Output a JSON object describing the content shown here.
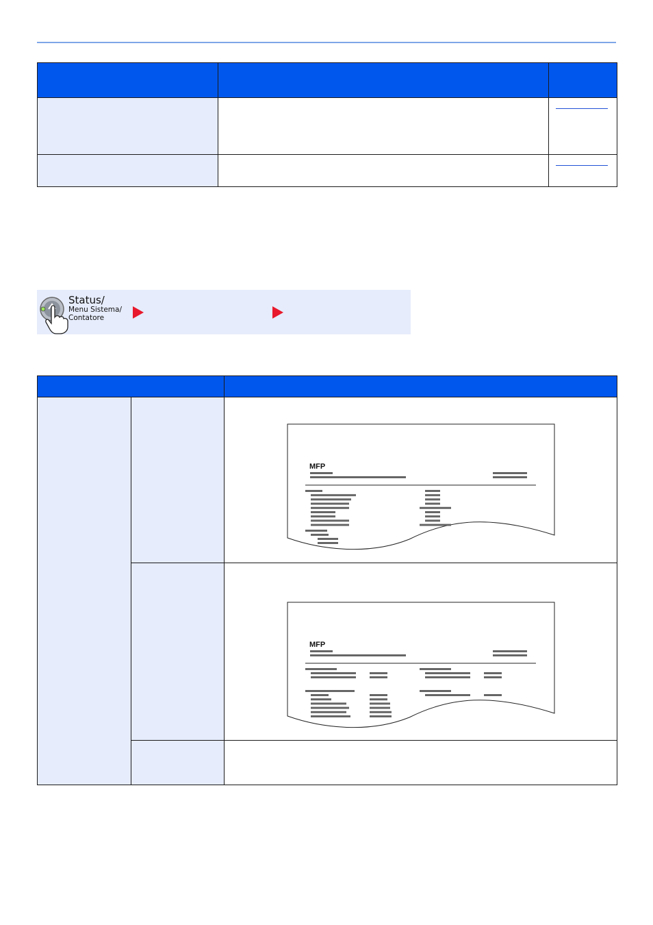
{
  "status_key": {
    "line1": "Status/",
    "line2": "Menu Sistema/",
    "line3": "Contatore"
  },
  "report_samples": [
    {
      "logo_text": "MFP"
    },
    {
      "logo_text": "MFP"
    }
  ],
  "colors": {
    "header_blue": "#0057ee",
    "row_shade": "#e6ecfb",
    "rule": "#7ea6e8",
    "arrow_red": "#e8192c"
  }
}
